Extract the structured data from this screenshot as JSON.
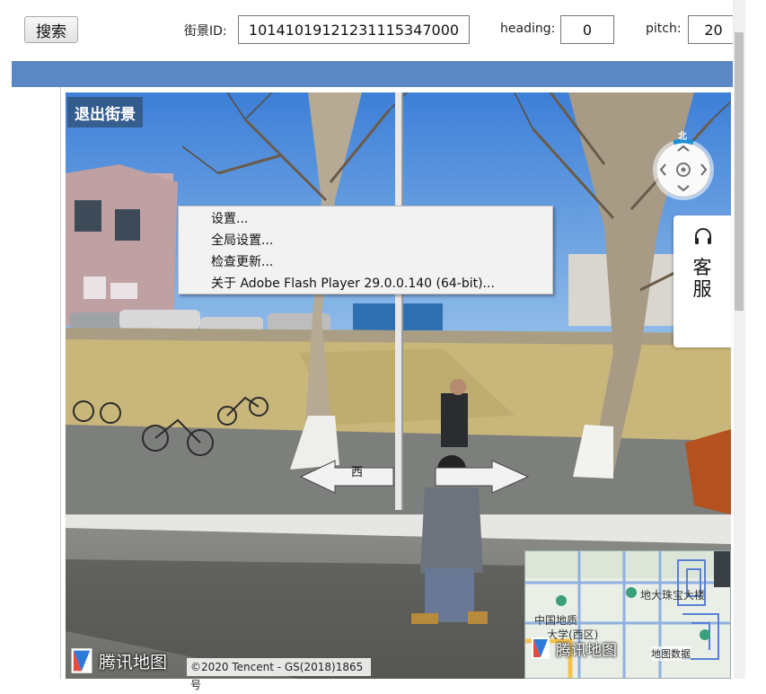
{
  "toolbar": {
    "search_label": "搜索",
    "pano_id_label": "街景ID:",
    "pano_id_value": "10141019121231115347000",
    "heading_label": "heading:",
    "heading_value": "0",
    "pitch_label": "pitch:",
    "pitch_value": "20"
  },
  "streetview": {
    "exit_label": "退出街景",
    "compass_north": "北",
    "arrow_west_label": "西",
    "service_label": "客\n服",
    "copyright": "©2020 Tencent - GS(2018)1865号",
    "logo_text": "腾讯地图",
    "minimap": {
      "labels": [
        "地大珠宝大楼",
        "中国地质",
        "大学(西区)"
      ],
      "logo_text": "腾讯地图",
      "data_label": "地图数据"
    }
  },
  "context_menu": {
    "items": [
      "设置...",
      "全局设置...",
      "检查更新...",
      "关于 Adobe Flash Player 29.0.0.140 (64-bit)..."
    ]
  },
  "colors": {
    "blue_bar": "#5b87c5",
    "compass_accent": "#1e8fd6"
  }
}
